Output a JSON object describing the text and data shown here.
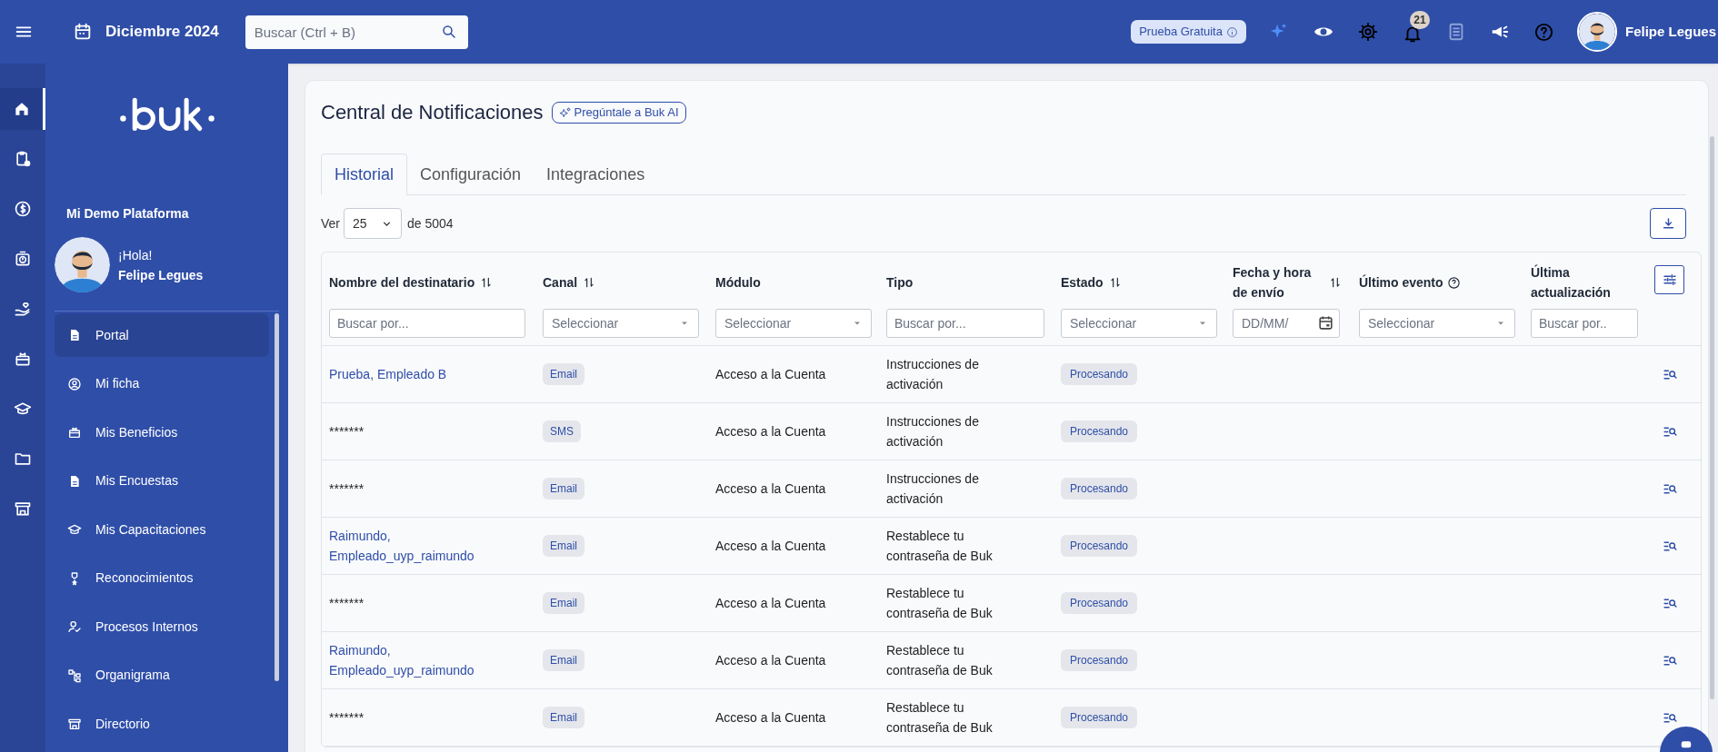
{
  "topbar": {
    "date": "Diciembre 2024",
    "search": {
      "placeholder": "Buscar (Ctrl + B)"
    },
    "trial_badge": "Prueba Gratuita",
    "notifications": "21",
    "user": "Felipe Legues"
  },
  "rail": [
    {
      "selected": true
    },
    {
      "selected": false
    },
    {
      "selected": false
    },
    {
      "selected": false
    },
    {
      "selected": false
    },
    {
      "selected": false
    },
    {
      "selected": false
    },
    {
      "selected": false
    },
    {
      "selected": false
    }
  ],
  "sidebar": {
    "org": "Mi Demo Plataforma",
    "greeting": "¡Hola!",
    "user": "Felipe Legues",
    "items": [
      {
        "label": "Portal",
        "selected": true
      },
      {
        "label": "Mi ficha",
        "selected": false
      },
      {
        "label": "Mis Beneficios",
        "selected": false
      },
      {
        "label": "Mis Encuestas",
        "selected": false
      },
      {
        "label": "Mis Capacitaciones",
        "selected": false
      },
      {
        "label": "Reconocimientos",
        "selected": false
      },
      {
        "label": "Procesos Internos",
        "selected": false
      },
      {
        "label": "Organigrama",
        "selected": false
      },
      {
        "label": "Directorio",
        "selected": false
      }
    ]
  },
  "main": {
    "title": "Central de Notificaciones",
    "ai_button": "Pregúntale a Buk AI",
    "tabs": [
      {
        "label": "Historial",
        "selected": true
      },
      {
        "label": "Configuración",
        "selected": false
      },
      {
        "label": "Integraciones",
        "selected": false
      }
    ],
    "page_size": {
      "prefix": "Ver",
      "value": "25",
      "suffix": "de 5004"
    },
    "table": {
      "columns": [
        {
          "label": "Nombre del destinatario",
          "sortable": true,
          "filter": {
            "kind": "text",
            "placeholder": "Buscar por..."
          }
        },
        {
          "label": "Canal",
          "sortable": true,
          "filter": {
            "kind": "select",
            "placeholder": "Seleccionar"
          }
        },
        {
          "label": "Módulo",
          "sortable": false,
          "filter": {
            "kind": "select",
            "placeholder": "Seleccionar"
          }
        },
        {
          "label": "Tipo",
          "sortable": false,
          "filter": {
            "kind": "text",
            "placeholder": "Buscar por..."
          }
        },
        {
          "label": "Estado",
          "sortable": true,
          "filter": {
            "kind": "select",
            "placeholder": "Seleccionar"
          }
        },
        {
          "label": "Fecha y hora de envío",
          "sortable": true,
          "filter": {
            "kind": "date",
            "placeholder": "DD/MM/"
          }
        },
        {
          "label": "Último evento",
          "sortable": false,
          "help": true,
          "filter": {
            "kind": "select",
            "placeholder": "Seleccionar"
          }
        },
        {
          "label": "Última actualización",
          "sortable": false,
          "filter": {
            "kind": "text",
            "placeholder": "Buscar por.."
          }
        }
      ],
      "rows": [
        {
          "name": "Prueba, Empleado B",
          "link": true,
          "canal": "Email",
          "modulo": "Acceso a la Cuenta",
          "tipo": "Instrucciones de activación",
          "estado": "Procesando"
        },
        {
          "name": "*******",
          "link": false,
          "canal": "SMS",
          "modulo": "Acceso a la Cuenta",
          "tipo": "Instrucciones de activación",
          "estado": "Procesando"
        },
        {
          "name": "*******",
          "link": false,
          "canal": "Email",
          "modulo": "Acceso a la Cuenta",
          "tipo": "Instrucciones de activación",
          "estado": "Procesando"
        },
        {
          "name": "Raimundo, Empleado_uyp_raimundo",
          "link": true,
          "canal": "Email",
          "modulo": "Acceso a la Cuenta",
          "tipo": "Restablece tu contraseña de Buk",
          "estado": "Procesando"
        },
        {
          "name": "*******",
          "link": false,
          "canal": "Email",
          "modulo": "Acceso a la Cuenta",
          "tipo": "Restablece tu contraseña de Buk",
          "estado": "Procesando"
        },
        {
          "name": "Raimundo, Empleado_uyp_raimundo",
          "link": true,
          "canal": "Email",
          "modulo": "Acceso a la Cuenta",
          "tipo": "Restablece tu contraseña de Buk",
          "estado": "Procesando"
        },
        {
          "name": "*******",
          "link": false,
          "canal": "Email",
          "modulo": "Acceso a la Cuenta",
          "tipo": "Restablece tu contraseña de Buk",
          "estado": "Procesando"
        }
      ]
    }
  }
}
